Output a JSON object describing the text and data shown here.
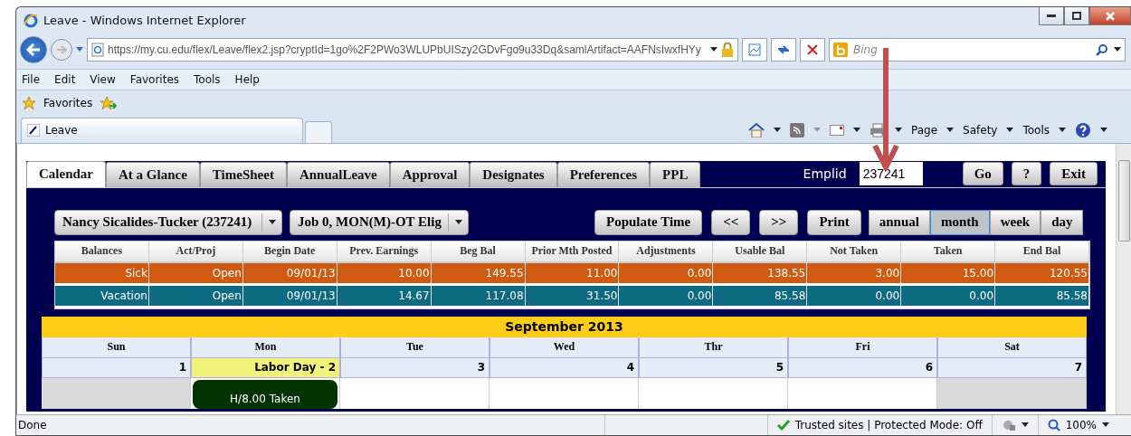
{
  "window": {
    "title": "Leave - Windows Internet Explorer"
  },
  "address": {
    "url": "https://my.cu.edu/flex/Leave/flex2.jsp?cryptId=1go%2F2PWo3WLUPbUISzy2GDvFgo9u33Dq&samlArtifact=AAFNsIwxfHYy"
  },
  "search": {
    "placeholder": "Bing"
  },
  "menu": [
    "File",
    "Edit",
    "View",
    "Favorites",
    "Tools",
    "Help"
  ],
  "favorites": {
    "label": "Favorites"
  },
  "browser_tabs": [
    {
      "label": "Leave",
      "selected": true
    }
  ],
  "command_bar": [
    "Page",
    "Safety",
    "Tools"
  ],
  "app": {
    "tabs": [
      {
        "label": "Calendar",
        "selected": true
      },
      {
        "label": "At a Glance",
        "selected": false
      },
      {
        "label": "TimeSheet",
        "selected": false
      },
      {
        "label": "AnnualLeave",
        "selected": false
      },
      {
        "label": "Approval",
        "selected": false
      },
      {
        "label": "Designates",
        "selected": false
      },
      {
        "label": "Preferences",
        "selected": false
      },
      {
        "label": "PPL",
        "selected": false
      }
    ],
    "emplid": {
      "label": "Emplid",
      "value": "237241"
    },
    "top_buttons": [
      "Go",
      "?",
      "Exit"
    ],
    "employee_select": "Nancy Sicalides-Tucker (237241)",
    "job_select": "Job 0, MON(M)-OT Elig",
    "actions": [
      "Populate Time",
      "<<",
      ">>",
      "Print"
    ],
    "views": [
      {
        "label": "annual",
        "selected": false
      },
      {
        "label": "month",
        "selected": true
      },
      {
        "label": "week",
        "selected": false
      },
      {
        "label": "day",
        "selected": false
      }
    ],
    "balances": {
      "columns": [
        "Balances",
        "Act/Proj",
        "Begin Date",
        "Prev. Earnings",
        "Beg Bal",
        "Prior Mth Posted",
        "Adjustments",
        "Usable Bal",
        "Not Taken",
        "Taken",
        "End Bal"
      ],
      "rows": [
        {
          "color": "#cf5a12",
          "cells": [
            "Sick",
            "Open",
            "09/01/13",
            "10.00",
            "149.55",
            "11.00",
            "0.00",
            "138.55",
            "3.00",
            "15.00",
            "120.55"
          ]
        },
        {
          "color": "#0e6a80",
          "cells": [
            "Vacation",
            "Open",
            "09/01/13",
            "14.67",
            "117.08",
            "31.50",
            "0.00",
            "85.58",
            "0.00",
            "0.00",
            "85.58"
          ]
        }
      ]
    },
    "calendar": {
      "title": "September 2013",
      "days": [
        "Sun",
        "Mon",
        "Tue",
        "Wed",
        "Thr",
        "Fri",
        "Sat"
      ],
      "dates": [
        {
          "kind": "plain",
          "label": "1"
        },
        {
          "kind": "holiday",
          "label": "Labor Day - 2"
        },
        {
          "kind": "plain",
          "label": "3"
        },
        {
          "kind": "plain",
          "label": "4"
        },
        {
          "kind": "plain",
          "label": "5"
        },
        {
          "kind": "plain",
          "label": "6"
        },
        {
          "kind": "plain",
          "label": "7"
        }
      ],
      "cells": [
        {
          "kind": "weekend"
        },
        {
          "kind": "event",
          "label": "H/8.00 Taken"
        },
        {
          "kind": "day"
        },
        {
          "kind": "day"
        },
        {
          "kind": "day"
        },
        {
          "kind": "day"
        },
        {
          "kind": "weekend"
        }
      ]
    }
  },
  "status": {
    "text": "Done",
    "zone": "Trusted sites | Protected Mode: Off",
    "zoom": "100%"
  }
}
